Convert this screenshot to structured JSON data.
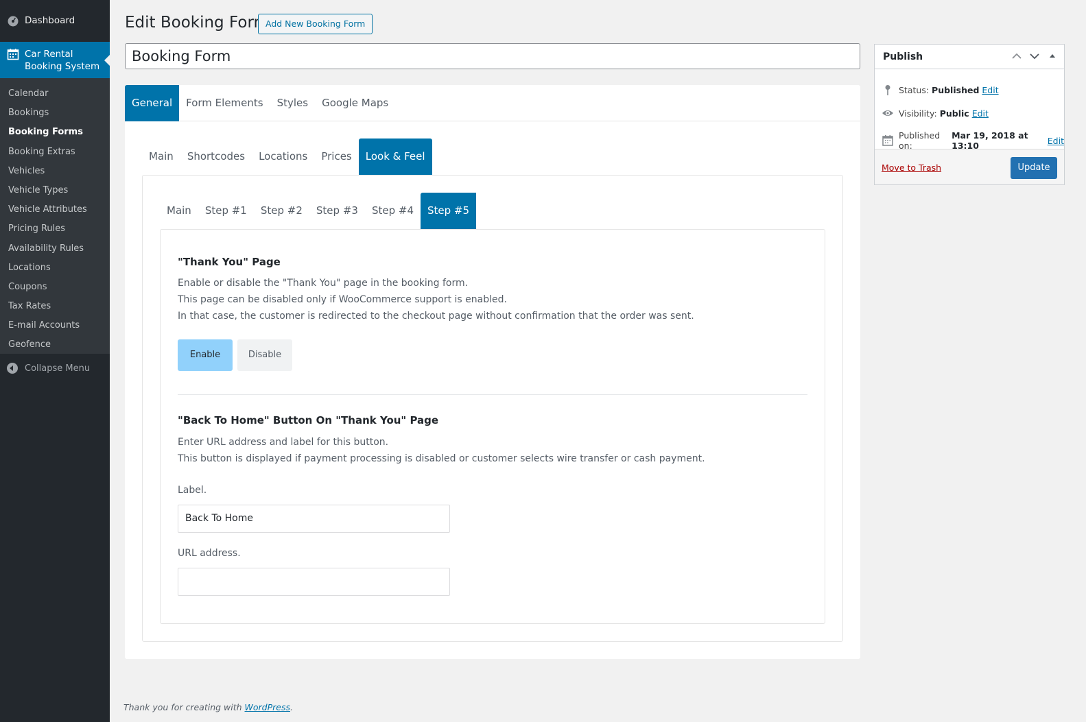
{
  "sidebar": {
    "dashboard": "Dashboard",
    "current_line1": "Car Rental",
    "current_line2": "Booking System",
    "items": [
      {
        "label": "Calendar"
      },
      {
        "label": "Bookings"
      },
      {
        "label": "Booking Forms"
      },
      {
        "label": "Booking Extras"
      },
      {
        "label": "Vehicles"
      },
      {
        "label": "Vehicle Types"
      },
      {
        "label": "Vehicle Attributes"
      },
      {
        "label": "Pricing Rules"
      },
      {
        "label": "Availability Rules"
      },
      {
        "label": "Locations"
      },
      {
        "label": "Coupons"
      },
      {
        "label": "Tax Rates"
      },
      {
        "label": "E-mail Accounts"
      },
      {
        "label": "Geofence"
      }
    ],
    "collapse": "Collapse Menu"
  },
  "header": {
    "title": "Edit Booking Form",
    "add_new": "Add New Booking Form",
    "post_title": "Booking Form"
  },
  "tabs_main": [
    "General",
    "Form Elements",
    "Styles",
    "Google Maps"
  ],
  "tabs_sub": [
    "Main",
    "Shortcodes",
    "Locations",
    "Prices",
    "Look & Feel"
  ],
  "tabs_step": [
    "Main",
    "Step #1",
    "Step #2",
    "Step #3",
    "Step #4",
    "Step #5"
  ],
  "thank_you": {
    "title": "\"Thank You\" Page",
    "line1": "Enable or disable the \"Thank You\" page in the booking form.",
    "line2": "This page can be disabled only if WooCommerce support is enabled.",
    "line3": "In that case, the customer is redirected to the checkout page without confirmation that the order was sent.",
    "enable": "Enable",
    "disable": "Disable"
  },
  "back_home": {
    "title": "\"Back To Home\" Button On \"Thank You\" Page",
    "line1": "Enter URL address and label for this button.",
    "line2": "This button is displayed if payment processing is disabled or customer selects wire transfer or cash payment.",
    "label_label": "Label.",
    "label_value": "Back To Home",
    "url_label": "URL address.",
    "url_value": ""
  },
  "publish": {
    "title": "Publish",
    "status_label": "Status:",
    "status_value": "Published",
    "visibility_label": "Visibility:",
    "visibility_value": "Public",
    "published_label": "Published on:",
    "published_value": "Mar 19, 2018 at 13:10",
    "edit": "Edit",
    "trash": "Move to Trash",
    "update": "Update"
  },
  "footer": {
    "text": "Thank you for creating with ",
    "link": "WordPress",
    "end": "."
  },
  "colors": {
    "accent": "#0073aa",
    "sidebar": "#23282d",
    "submenu": "#32373c",
    "enable_button": "#91d1fb"
  }
}
